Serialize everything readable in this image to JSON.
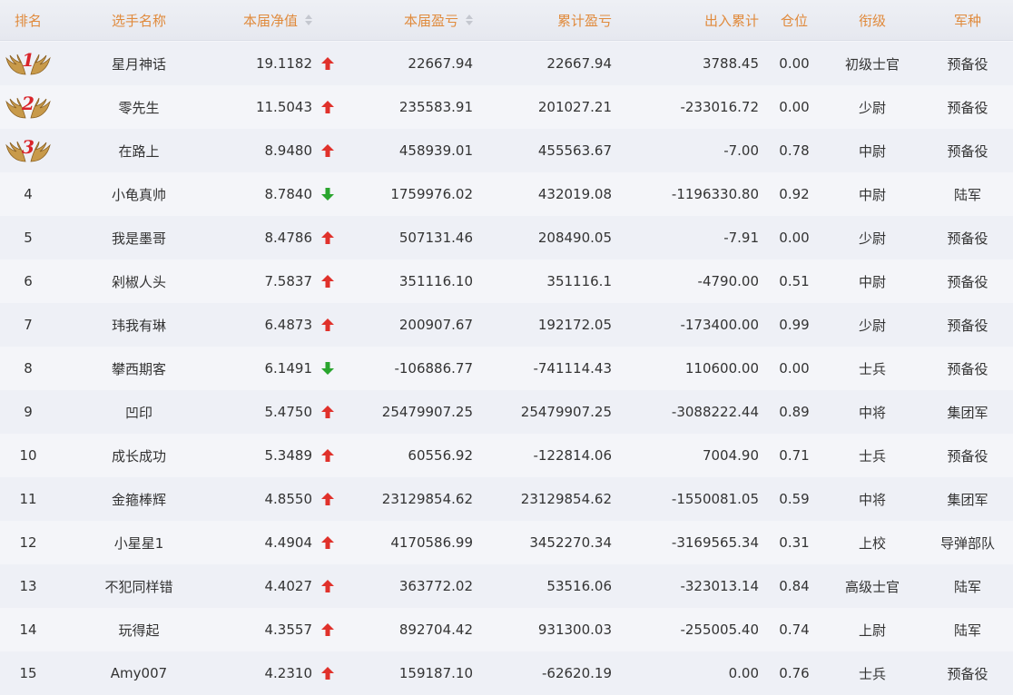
{
  "header": {
    "rank": "排名",
    "name": "选手名称",
    "nav": "本届净值",
    "current_pnl": "本届盈亏",
    "cumulative_pnl": "累计盈亏",
    "cash_flow": "出入累计",
    "position": "仓位",
    "title_rank": "衔级",
    "arm": "军种"
  },
  "colors": {
    "header_text": "#e08a3c",
    "up": "#e0312b",
    "down": "#2aa52e",
    "badge_number": "#d9242a"
  },
  "rows": [
    {
      "rank": "1",
      "name": "星月神话",
      "nav": "19.1182",
      "trend": "up",
      "current_pnl": "22667.94",
      "cumulative_pnl": "22667.94",
      "cash_flow": "3788.45",
      "position": "0.00",
      "title_rank": "初级士官",
      "arm": "预备役"
    },
    {
      "rank": "2",
      "name": "零先生",
      "nav": "11.5043",
      "trend": "up",
      "current_pnl": "235583.91",
      "cumulative_pnl": "201027.21",
      "cash_flow": "-233016.72",
      "position": "0.00",
      "title_rank": "少尉",
      "arm": "预备役"
    },
    {
      "rank": "3",
      "name": "在路上",
      "nav": "8.9480",
      "trend": "up",
      "current_pnl": "458939.01",
      "cumulative_pnl": "455563.67",
      "cash_flow": "-7.00",
      "position": "0.78",
      "title_rank": "中尉",
      "arm": "预备役"
    },
    {
      "rank": "4",
      "name": "小龟真帅",
      "nav": "8.7840",
      "trend": "down",
      "current_pnl": "1759976.02",
      "cumulative_pnl": "432019.08",
      "cash_flow": "-1196330.80",
      "position": "0.92",
      "title_rank": "中尉",
      "arm": "陆军"
    },
    {
      "rank": "5",
      "name": "我是墨哥",
      "nav": "8.4786",
      "trend": "up",
      "current_pnl": "507131.46",
      "cumulative_pnl": "208490.05",
      "cash_flow": "-7.91",
      "position": "0.00",
      "title_rank": "少尉",
      "arm": "预备役"
    },
    {
      "rank": "6",
      "name": "剁椒人头",
      "nav": "7.5837",
      "trend": "up",
      "current_pnl": "351116.10",
      "cumulative_pnl": "351116.1",
      "cash_flow": "-4790.00",
      "position": "0.51",
      "title_rank": "中尉",
      "arm": "预备役"
    },
    {
      "rank": "7",
      "name": "玮我有琳",
      "nav": "6.4873",
      "trend": "up",
      "current_pnl": "200907.67",
      "cumulative_pnl": "192172.05",
      "cash_flow": "-173400.00",
      "position": "0.99",
      "title_rank": "少尉",
      "arm": "预备役"
    },
    {
      "rank": "8",
      "name": "攀西期客",
      "nav": "6.1491",
      "trend": "down",
      "current_pnl": "-106886.77",
      "cumulative_pnl": "-741114.43",
      "cash_flow": "110600.00",
      "position": "0.00",
      "title_rank": "士兵",
      "arm": "预备役"
    },
    {
      "rank": "9",
      "name": "凹印",
      "nav": "5.4750",
      "trend": "up",
      "current_pnl": "25479907.25",
      "cumulative_pnl": "25479907.25",
      "cash_flow": "-3088222.44",
      "position": "0.89",
      "title_rank": "中将",
      "arm": "集团军"
    },
    {
      "rank": "10",
      "name": "成长成功",
      "nav": "5.3489",
      "trend": "up",
      "current_pnl": "60556.92",
      "cumulative_pnl": "-122814.06",
      "cash_flow": "7004.90",
      "position": "0.71",
      "title_rank": "士兵",
      "arm": "预备役"
    },
    {
      "rank": "11",
      "name": "金箍棒辉",
      "nav": "4.8550",
      "trend": "up",
      "current_pnl": "23129854.62",
      "cumulative_pnl": "23129854.62",
      "cash_flow": "-1550081.05",
      "position": "0.59",
      "title_rank": "中将",
      "arm": "集团军"
    },
    {
      "rank": "12",
      "name": "小星星1",
      "nav": "4.4904",
      "trend": "up",
      "current_pnl": "4170586.99",
      "cumulative_pnl": "3452270.34",
      "cash_flow": "-3169565.34",
      "position": "0.31",
      "title_rank": "上校",
      "arm": "导弹部队"
    },
    {
      "rank": "13",
      "name": "不犯同样错",
      "nav": "4.4027",
      "trend": "up",
      "current_pnl": "363772.02",
      "cumulative_pnl": "53516.06",
      "cash_flow": "-323013.14",
      "position": "0.84",
      "title_rank": "高级士官",
      "arm": "陆军"
    },
    {
      "rank": "14",
      "name": "玩得起",
      "nav": "4.3557",
      "trend": "up",
      "current_pnl": "892704.42",
      "cumulative_pnl": "931300.03",
      "cash_flow": "-255005.40",
      "position": "0.74",
      "title_rank": "上尉",
      "arm": "陆军"
    },
    {
      "rank": "15",
      "name": "Amy007",
      "nav": "4.2310",
      "trend": "up",
      "current_pnl": "159187.10",
      "cumulative_pnl": "-62620.19",
      "cash_flow": "0.00",
      "position": "0.76",
      "title_rank": "士兵",
      "arm": "预备役"
    }
  ]
}
